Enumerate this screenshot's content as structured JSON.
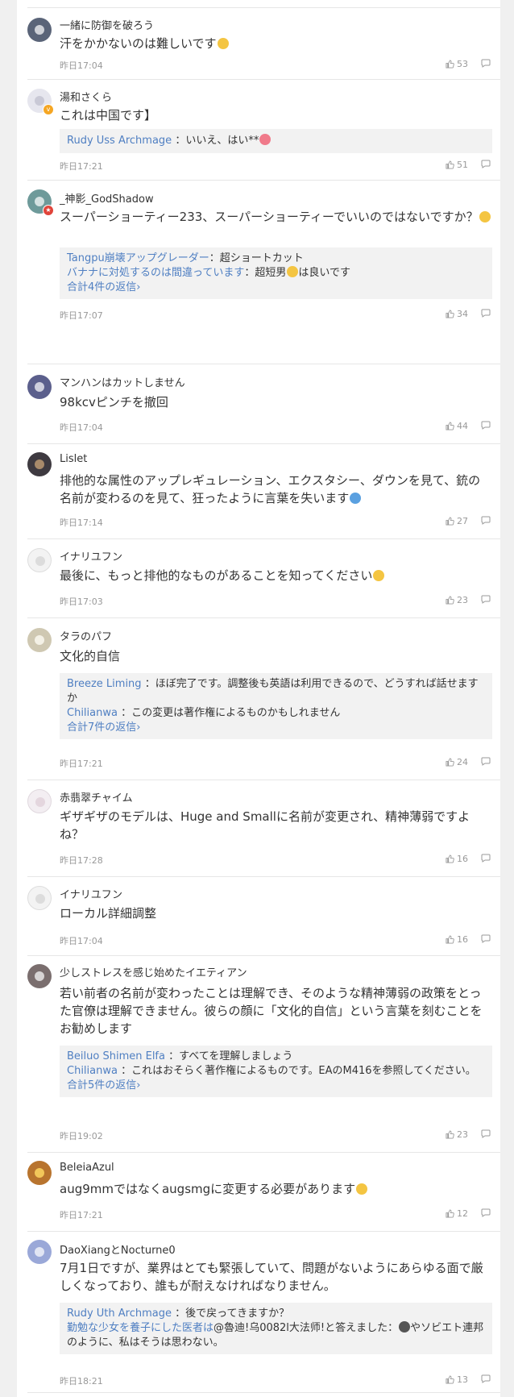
{
  "colors": {
    "link": "#4f7fc2",
    "meta": "#999999",
    "reply_bg": "#f2f2f2",
    "divider": "#e6e6e6"
  },
  "comments": [
    {
      "username": "一緒に防御を破ろう",
      "text": "汗をかかないのは難しいです",
      "time": "昨日17:04",
      "likes": "53",
      "avatar_icon": "avatar-photo-icon"
    },
    {
      "username": "湯和さくら",
      "text": "これは中国です】",
      "time": "昨日17:21",
      "likes": "51",
      "avatar_icon": "avatar-anime-icon",
      "replies": [
        {
          "user": "Rudy Uss Archmage",
          "text": "：いいえ、はい**"
        }
      ]
    },
    {
      "username": "_神影_GodShadow",
      "text": "スーパーショーティー233、スーパーショーティーでいいのではないですか？",
      "time": "昨日17:07",
      "likes": "34",
      "avatar_icon": "avatar-character-icon",
      "replies": [
        {
          "user": "Tangpu崩壊アップグレーダー",
          "text": "：超ショートカット"
        },
        {
          "user": "バナナに対処するのは間違っています",
          "text": "：超短男",
          "text2": "は良いです"
        }
      ],
      "more": "合計4件の返信"
    },
    {
      "username": "マンハンはカットしません",
      "text": "98kcvピンチを撤回",
      "time": "昨日17:04",
      "likes": "44",
      "avatar_icon": "avatar-anime-icon"
    },
    {
      "username": "Lislet",
      "text": "排他的な属性のアップレギュレーション、エクスタシー、ダウンを見て、銃の名前が変わるのを見て、狂ったように言葉を失います",
      "time": "昨日17:14",
      "likes": "27",
      "avatar_icon": "avatar-dark-icon"
    },
    {
      "username": "イナリユフン",
      "text": "最後に、もっと排他的なものがあることを知ってください",
      "time": "昨日17:03",
      "likes": "23",
      "avatar_icon": "avatar-sketch-icon"
    },
    {
      "username": "タラのパフ",
      "text": "文化的自信",
      "time": "昨日17:21",
      "likes": "24",
      "avatar_icon": "avatar-pet-icon",
      "replies": [
        {
          "user": "Breeze Liming",
          "text": "：ほぼ完了です。調整後も英語は利用できるので、どうすれば話せますか"
        },
        {
          "user": "Chilianwa",
          "text": "：この変更は著作権によるものかもしれません"
        }
      ],
      "more": "合計7件の返信"
    },
    {
      "username": "赤翡翠チャイム",
      "text": "ギザギザのモデルは、Huge and Smallに名前が変更され、精神薄弱ですよね？",
      "time": "昨日17:28",
      "likes": "16",
      "avatar_icon": "avatar-sketch-icon"
    },
    {
      "username": "イナリユフン",
      "text": "ローカル詳細調整",
      "time": "昨日17:04",
      "likes": "16",
      "avatar_icon": "avatar-sketch-icon"
    },
    {
      "username": "少しストレスを感じ始めたイエティアン",
      "text": "若い前者の名前が変わったことは理解でき、そのような精神薄弱の政策をとった官僚は理解できません。彼らの顔に「文化的自信」という言葉を刻むことをお勧めします",
      "time": "昨日19:02",
      "likes": "23",
      "avatar_icon": "avatar-character-icon",
      "replies": [
        {
          "user": "Beiluo Shimen Elfa",
          "text": "：すべてを理解しましょう"
        },
        {
          "user": "Chilianwa",
          "text": "：これはおそらく著作権によるものです。EAのM416を参照してください。"
        }
      ],
      "more": "合計5件の返信"
    },
    {
      "username": "BeleiaAzul",
      "text": "aug9mmではなくaugsmgに変更する必要があります",
      "time": "昨日17:21",
      "likes": "12",
      "avatar_icon": "avatar-sunset-icon"
    },
    {
      "username": "DaoXiangとNocturne0",
      "text": "7月1日ですが、業界はとても緊張していて、問題がないようにあらゆる面で厳しくなっており、誰もが耐えなければなりません。",
      "time": "昨日18:21",
      "likes": "13",
      "avatar_icon": "avatar-anime-icon",
      "replies": [
        {
          "user": "Rudy Uth Archmage",
          "text": "：後で戻ってきますか？"
        },
        {
          "user": "勤勉な少女を養子にした医者は",
          "text": "@魯迪!乌0082l大法师!と答えました：",
          "text2": "やソビエト連邦のように、私はそうは思わない。"
        }
      ]
    }
  ]
}
